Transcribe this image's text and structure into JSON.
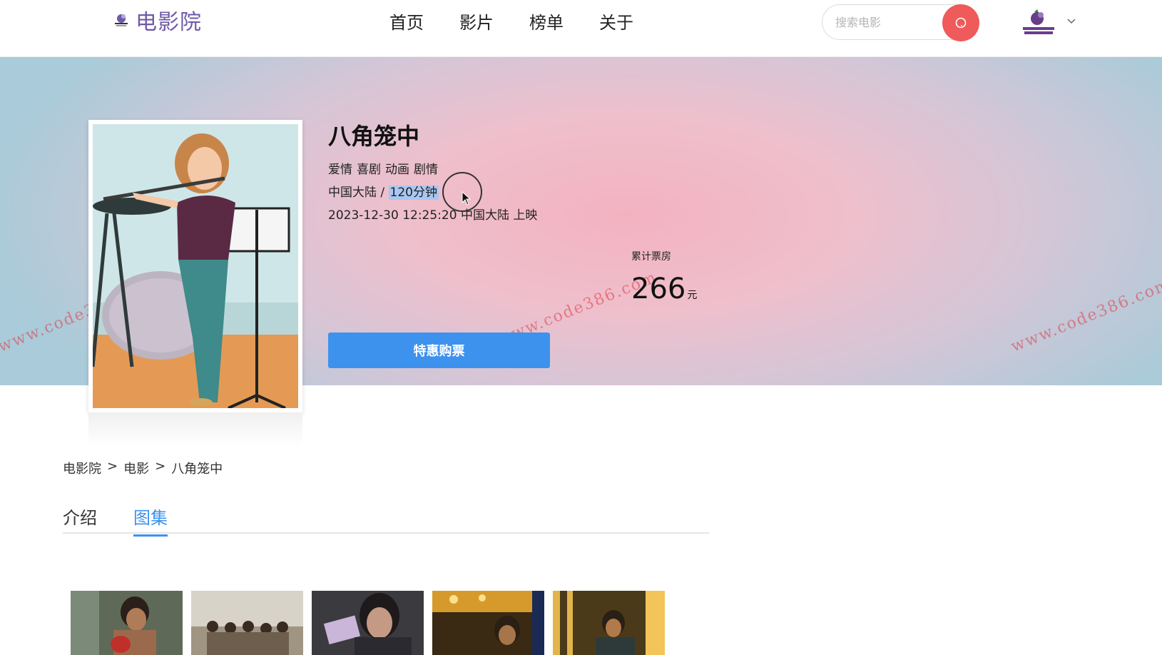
{
  "header": {
    "logo_text": "电影院",
    "nav": [
      "首页",
      "影片",
      "榜单",
      "关于"
    ],
    "search_placeholder": "搜索电影"
  },
  "movie": {
    "title": "八角笼中",
    "genres": [
      "爱情",
      "喜剧",
      "动画",
      "剧情"
    ],
    "region": "中国大陆",
    "separator": "/",
    "duration": "120分钟",
    "release": "2023-12-30 12:25:20 中国大陆 上映",
    "box_office_label": "累计票房",
    "box_office_value": "266",
    "box_office_unit": "元",
    "buy_label": "特惠购票"
  },
  "watermark": "www.code386.com",
  "breadcrumb": [
    "电影院",
    "电影",
    "八角笼中"
  ],
  "breadcrumb_sep": ">",
  "tabs": [
    "介绍",
    "图集"
  ],
  "active_tab": "图集",
  "colors": {
    "accent": "#3d92ee",
    "search_button": "#ef5a5a",
    "logo": "#6f5aa8"
  }
}
